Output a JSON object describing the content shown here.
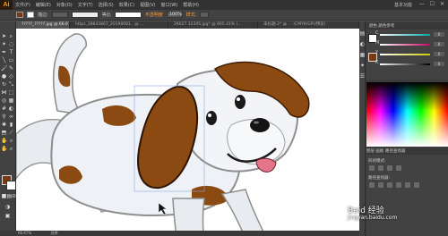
{
  "app": {
    "logo": "Ai",
    "workspace": "基本功能",
    "window_controls": [
      "—",
      "☐",
      "✕"
    ]
  },
  "menu": [
    "文件(F)",
    "编辑(E)",
    "对象(O)",
    "文字(T)",
    "选择(S)",
    "效果(C)",
    "视图(V)",
    "窗口(W)",
    "帮助(H)"
  ],
  "control_bar": {
    "fill_color": "#7a3a0e",
    "stroke_color": "#ffffff",
    "stroke_label": "描边:",
    "stroke_value": "",
    "profile_label": "等比",
    "style_label": "不透明度",
    "opacity_value": "100%",
    "style_orange": "样式:"
  },
  "tabs": [
    {
      "label": "?????_?????.jpg @ 66.67% (CMYK/预览)",
      "active": true
    },
    {
      "label": "https_28843867_20190081.. @ ...",
      "active": false
    },
    {
      "label": "26627 12345.jpg* @ 665.41% (...",
      "active": false
    },
    {
      "label": "未标题-2* @ ... (CMYK/GPU预览)",
      "active": false
    }
  ],
  "color_panel": {
    "tabs_label": "颜色  颜色参考",
    "sliders": [
      {
        "label": "C",
        "value": "0"
      },
      {
        "label": "M",
        "value": "0"
      },
      {
        "label": "Y",
        "value": "0"
      },
      {
        "label": "K",
        "value": "0"
      }
    ]
  },
  "bottom_panel": {
    "tabs_label": "图层  画板  路径查找器",
    "title_1": "形状模式:",
    "title_2": "路径查找器:"
  },
  "status_bar": {
    "zoom": "66.67%",
    "text": "选择"
  },
  "watermark": {
    "main": "Baid 经验",
    "sub": "jingyan.baidu.com"
  },
  "colors": {
    "brown": "#7a3a0e",
    "canvas": "#ffffff",
    "ui_dark": "#424242"
  }
}
